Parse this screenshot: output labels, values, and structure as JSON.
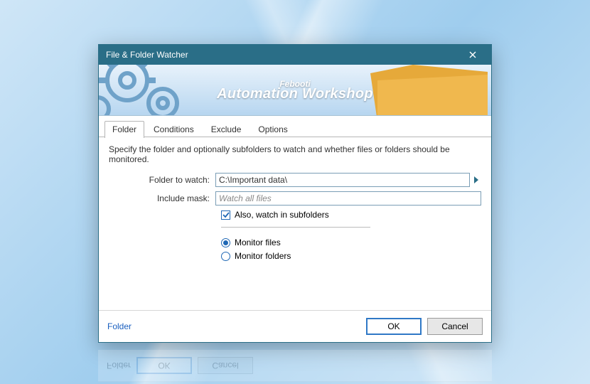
{
  "window": {
    "title": "File & Folder Watcher"
  },
  "banner": {
    "brand_small": "Febooti",
    "brand_big": "Automation Workshop"
  },
  "tabs": [
    {
      "label": "Folder",
      "active": true
    },
    {
      "label": "Conditions",
      "active": false
    },
    {
      "label": "Exclude",
      "active": false
    },
    {
      "label": "Options",
      "active": false
    }
  ],
  "folder_tab": {
    "description": "Specify the folder and optionally subfolders to watch and whether files or folders should be monitored.",
    "folder_label": "Folder to watch:",
    "folder_value": "C:\\Important data\\",
    "mask_label": "Include mask:",
    "mask_placeholder": "Watch all files",
    "subfolders_label": "Also, watch in subfolders",
    "subfolders_checked": true,
    "monitor_files_label": "Monitor files",
    "monitor_folders_label": "Monitor folders",
    "monitor_selected": "files"
  },
  "footer": {
    "link": "Folder",
    "ok": "OK",
    "cancel": "Cancel"
  }
}
